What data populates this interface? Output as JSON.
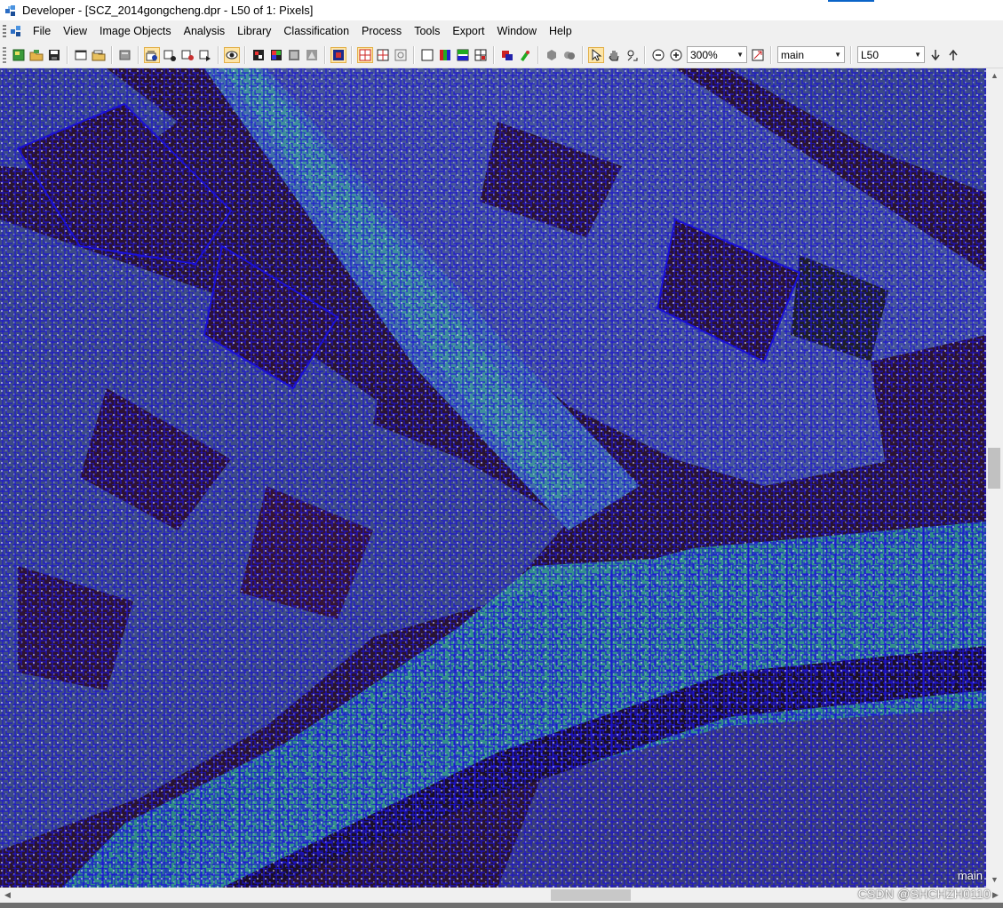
{
  "window": {
    "title": "Developer - [SCZ_2014gongcheng.dpr - L50 of 1: Pixels]",
    "app_icon": "ecognition-app-icon"
  },
  "menu": {
    "items": [
      "File",
      "View",
      "Image Objects",
      "Analysis",
      "Library",
      "Classification",
      "Process",
      "Tools",
      "Export",
      "Window",
      "Help"
    ]
  },
  "toolbar": {
    "zoom_value": "300%",
    "map_value": "main",
    "level_value": "L50",
    "groups": [
      [
        "new-project-icon",
        "open-project-icon",
        "save-project-icon"
      ],
      [
        "new-workspace-icon",
        "open-workspace-icon"
      ],
      [
        "manage-data-icon"
      ],
      [
        "image-object-info-icon",
        "object-table-icon",
        "feature-view-icon",
        "class-hierarchy-icon"
      ],
      [
        "sample-editor-icon"
      ],
      [
        "view-layers-icon",
        "view-classification-icon",
        "view-samples-icon",
        "view-polygons-icon"
      ],
      [
        "mix-layers-icon"
      ],
      [
        "show-outlines-icon",
        "show-polygons-icon",
        "show-skeletons-icon"
      ],
      [
        "single-layer-icon",
        "three-layer-mix-icon",
        "split-view-icon",
        "tile-view-icon"
      ],
      [
        "classify-icon",
        "manual-edit-icon"
      ],
      [
        "polygon-tool-icon",
        "merge-tool-icon"
      ],
      [
        "select-cursor-icon",
        "pan-hand-icon",
        "area-zoom-icon"
      ],
      [
        "zoom-out-icon",
        "zoom-in-icon"
      ],
      [
        "zoom-fit-icon"
      ],
      [
        "level-down-icon",
        "level-up-icon"
      ]
    ]
  },
  "viewer": {
    "overlay_label": "main",
    "description_colors": {
      "segment_outline": "#1a10d8",
      "dark_region": "#2a1430",
      "urban_mid": "#3d4c86",
      "water_teal": "#2f8a86"
    }
  },
  "watermark": "CSDN @SHCHZH0110"
}
